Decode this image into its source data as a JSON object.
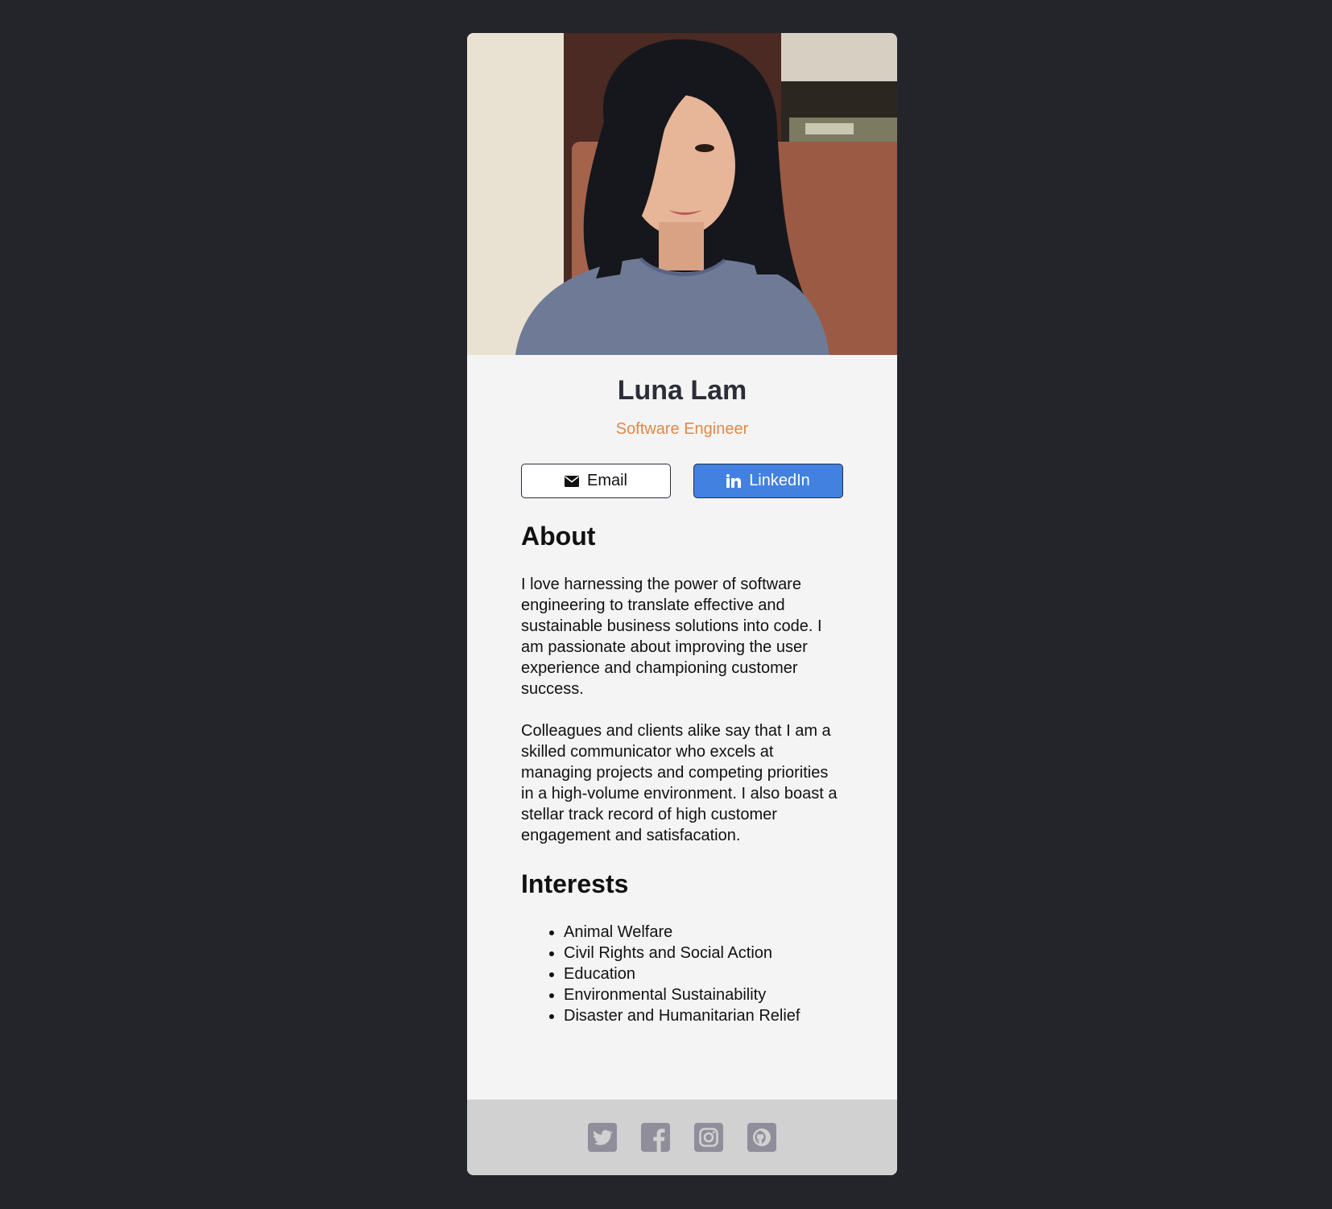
{
  "profile": {
    "name": "Luna Lam",
    "title": "Software Engineer",
    "photo_icon": "profile-photo"
  },
  "actions": {
    "email_label": "Email",
    "email_icon": "envelope-icon",
    "linkedin_label": "LinkedIn",
    "linkedin_icon": "linkedin-icon"
  },
  "about": {
    "heading": "About",
    "paragraphs": [
      "I love harnessing the power of software engineering to translate effective and sustainable business solutions into code. I am passionate about improving the user experience and championing customer success.",
      "Colleagues and clients alike say that I am a skilled communicator who excels at managing projects and competing priorities in a high-volume environment. I also boast a stellar track record of high customer engagement and satisfacation."
    ]
  },
  "interests": {
    "heading": "Interests",
    "items": [
      "Animal Welfare",
      "Civil Rights and Social Action",
      "Education",
      "Environmental Sustainability",
      "Disaster and Humanitarian Relief"
    ]
  },
  "footer": {
    "icons": [
      "twitter-icon",
      "facebook-icon",
      "instagram-icon",
      "github-icon"
    ]
  },
  "colors": {
    "background": "#23252b",
    "card": "#f4f4f4",
    "footer": "#d1d1d1",
    "accent_title": "#e0894a",
    "linkedin_button": "#4281e0",
    "name_text": "#2b2d3a",
    "footer_icons": "#918e9b"
  }
}
